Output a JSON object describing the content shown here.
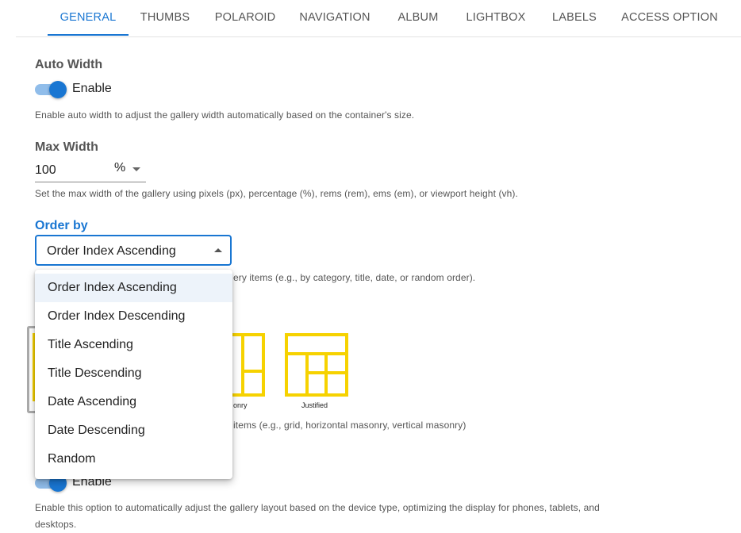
{
  "tabs": [
    {
      "label": "GENERAL"
    },
    {
      "label": "THUMBS"
    },
    {
      "label": "POLAROID"
    },
    {
      "label": "NAVIGATION"
    },
    {
      "label": "ALBUM"
    },
    {
      "label": "LIGHTBOX"
    },
    {
      "label": "LABELS"
    },
    {
      "label": "ACCESS OPTION"
    }
  ],
  "auto_width": {
    "title": "Auto Width",
    "toggle_label": "Enable",
    "help": "Enable auto width to adjust the gallery width automatically based on the container's size."
  },
  "max_width": {
    "title": "Max Width",
    "value": "100",
    "unit": "%",
    "help": "Set the max width of the gallery using pixels (px), percentage (%), rems (rem), ems (em), or viewport height (vh)."
  },
  "order_by": {
    "title": "Order by",
    "selected": "Order Index Ascending",
    "help_visible": "ery items (e.g., by category, title, date, or random order).",
    "options": [
      "Order Index Ascending",
      "Order Index Descending",
      "Title Ascending",
      "Title Descending",
      "Date Ascending",
      "Date Descending",
      "Random"
    ]
  },
  "layout": {
    "captions": [
      "onry",
      "Justified"
    ],
    "help_visible": "items (e.g., grid, horizontal masonry, vertical masonry)"
  },
  "responsive": {
    "toggle_label": "Enable",
    "help_line1": "Enable this option to automatically adjust the gallery layout based on the device type, optimizing the display for phones, tablets, and",
    "help_line2": "desktops."
  },
  "colors": {
    "accent": "#1976d2",
    "thumbnail": "#f6d200"
  }
}
